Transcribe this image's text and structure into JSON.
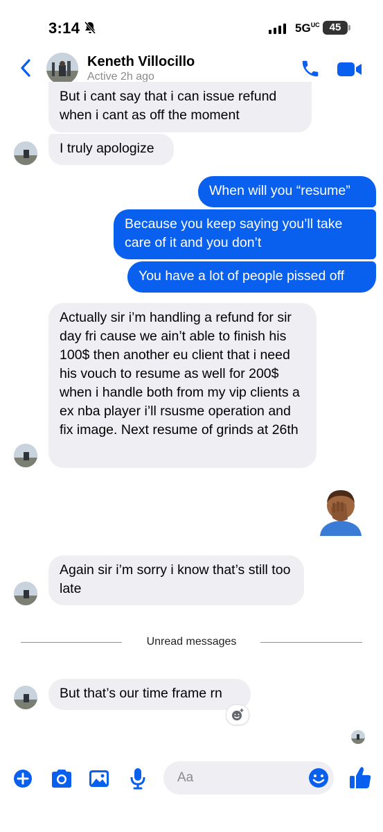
{
  "status_bar": {
    "time": "3:14",
    "network": "5G",
    "network_suffix": "UC",
    "battery": "45"
  },
  "header": {
    "name": "Keneth Villocillo",
    "status": "Active 2h ago"
  },
  "messages": [
    {
      "from": "them",
      "text": "But i cant say that i can issue refund when i cant as off the moment"
    },
    {
      "from": "them",
      "text": "I truly apologize"
    },
    {
      "from": "me",
      "text": "When will you “resume”"
    },
    {
      "from": "me",
      "text": "Because you keep saying you’ll take care of it and you don’t"
    },
    {
      "from": "me",
      "text": "You have a lot of people pissed off"
    },
    {
      "from": "them",
      "text": "Actually sir i’m handling a refund for sir day fri cause we ain’t able to finish his 100$ then another eu client that i need his vouch to resume as well for 200$ when i handle both from my vip clients a ex nba player i’ll rsusme operation and fix image. Next resume of grinds at 26th"
    },
    {
      "from": "me",
      "emoji": "facepalm"
    },
    {
      "from": "them",
      "text": "Again sir i’m sorry i know that’s still too late"
    },
    {
      "from": "them",
      "text": "But that’s our time frame rn"
    }
  ],
  "unread_divider": "Unread messages",
  "composer": {
    "placeholder": "Aa"
  },
  "colors": {
    "accent": "#0a60ee",
    "incoming_bubble": "#efeff3",
    "outgoing_bubble": "#0a60ee"
  },
  "icons": [
    "back-icon",
    "phone-icon",
    "video-icon",
    "plus-icon",
    "camera-icon",
    "gallery-icon",
    "mic-icon",
    "emoji-icon",
    "like-icon",
    "add-reaction-icon",
    "facepalm-emoji",
    "bell-slash-icon"
  ]
}
